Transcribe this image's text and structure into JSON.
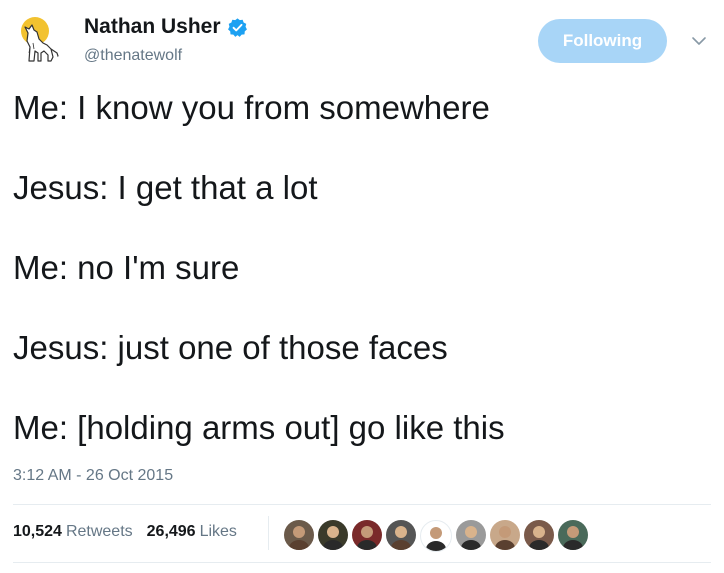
{
  "author": {
    "display_name": "Nathan Usher",
    "handle": "@thenatewolf",
    "verified": true,
    "avatar_icon": "howling-wolf-moon-icon"
  },
  "follow_button": {
    "label": "Following",
    "color": "#a8d5f7"
  },
  "menu": {
    "icon": "chevron-down-icon"
  },
  "tweet": {
    "lines": [
      "Me: I know you from somewhere",
      "Jesus: I get that a lot",
      "Me: no I'm sure",
      "Jesus: just one of those faces",
      "Me: [holding arms out] go like this"
    ],
    "timestamp": "3:12 AM - 26 Oct 2015"
  },
  "stats": {
    "retweets_count": "10,524",
    "retweets_label": "Retweets",
    "likes_count": "26,496",
    "likes_label": "Likes"
  },
  "likers": [
    {
      "name": "liker-avatar-1",
      "color": "#6b5a4a"
    },
    {
      "name": "liker-avatar-2",
      "color": "#3a3a2a"
    },
    {
      "name": "liker-avatar-3",
      "color": "#7a2a2a"
    },
    {
      "name": "liker-avatar-4",
      "color": "#555555"
    },
    {
      "name": "liker-avatar-5",
      "color": "#ffffff"
    },
    {
      "name": "liker-avatar-6",
      "color": "#9a9a9a"
    },
    {
      "name": "liker-avatar-7",
      "color": "#c8a88a"
    },
    {
      "name": "liker-avatar-8",
      "color": "#7a5a4a"
    },
    {
      "name": "liker-avatar-9",
      "color": "#4a6a5a"
    }
  ],
  "colors": {
    "text": "#14171a",
    "secondary": "#657786",
    "accent": "#1da1f2",
    "divider": "#e6ecf0"
  }
}
